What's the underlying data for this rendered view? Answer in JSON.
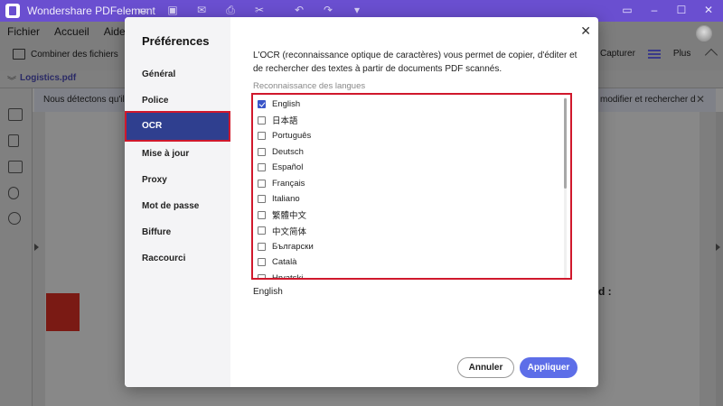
{
  "app": {
    "title": "Wondershare PDFelement",
    "accent": "#6a4fd0"
  },
  "quick_access_icons": [
    "folder-icon",
    "save-icon",
    "mail-icon",
    "print-icon",
    "scissors-icon",
    "undo-icon",
    "redo-icon",
    "dropdown-icon"
  ],
  "menu": {
    "items": [
      "Fichier",
      "Accueil",
      "Aide"
    ],
    "combine_label": "Combiner des fichiers",
    "capture_label": "Capturer",
    "plus_label": "Plus"
  },
  "tabbar": {
    "tab_label": "Logistics.pdf"
  },
  "notification": {
    "text_left": "Nous détectons qu'il s'a",
    "text_right": "modifier et rechercher d"
  },
  "document": {
    "colon": "d :"
  },
  "dialog": {
    "title": "Préférences",
    "nav": [
      "Général",
      "Police",
      "OCR",
      "Mise à jour",
      "Proxy",
      "Mot de passe",
      "Biffure",
      "Raccourci"
    ],
    "active_nav": "OCR",
    "description": "L'OCR (reconnaissance optique de caractères) vous permet de copier, d'éditer et de rechercher des textes à partir de documents PDF scannés.",
    "language_section_label": "Reconnaissance des langues",
    "languages": [
      {
        "label": "English",
        "checked": true
      },
      {
        "label": "日本語",
        "checked": false
      },
      {
        "label": "Português",
        "checked": false
      },
      {
        "label": "Deutsch",
        "checked": false
      },
      {
        "label": "Español",
        "checked": false
      },
      {
        "label": "Français",
        "checked": false
      },
      {
        "label": "Italiano",
        "checked": false
      },
      {
        "label": "繁體中文",
        "checked": false
      },
      {
        "label": "中文简体",
        "checked": false
      },
      {
        "label": "Български",
        "checked": false
      },
      {
        "label": "Català",
        "checked": false
      },
      {
        "label": "Hrvatski",
        "checked": false
      }
    ],
    "selected_languages": "English",
    "cancel_label": "Annuler",
    "apply_label": "Appliquer",
    "apply_color": "#5d6ee8",
    "highlight_color": "#d0182c"
  }
}
